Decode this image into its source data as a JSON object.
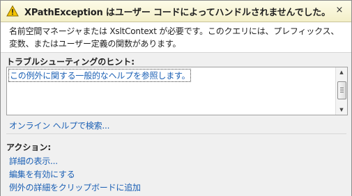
{
  "dialog": {
    "title": "XPathException はユーザー コードによってハンドルされませんでした。",
    "close_glyph": "×",
    "warning_icon": "warning-triangle-icon",
    "message": "名前空間マネージャまたは XsltContext が必要です。このクエリには、プレフィックス、変数、またはユーザー定義の関数があります。"
  },
  "hints": {
    "heading": "トラブルシューティングのヒント:",
    "items": [
      "この例外に関する一般的なヘルプを参照します。"
    ],
    "online_help": "オンライン ヘルプで検索..."
  },
  "actions": {
    "heading": "アクション:",
    "items": [
      "詳細の表示...",
      "編集を有効にする",
      "例外の詳細をクリップボードに追加"
    ]
  },
  "colors": {
    "title_bg": "#f7f3d4",
    "link": "#1a5fb4",
    "body_bg": "#f0f0f0"
  }
}
